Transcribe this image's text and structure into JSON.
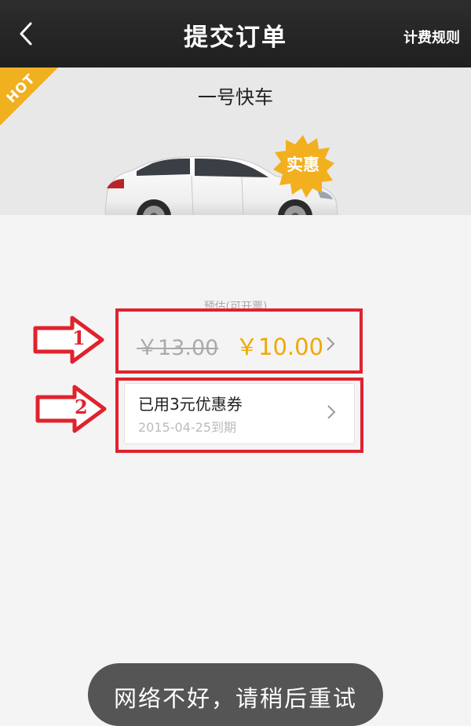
{
  "header": {
    "title": "提交订单",
    "rules_link": "计费规则"
  },
  "banner": {
    "ribbon": "HOT",
    "product_name": "一号快车",
    "badge": "实惠"
  },
  "pricing": {
    "estimate_label": "预估(可开票)",
    "original_price": "￥13.00",
    "discounted_price": "￥10.00"
  },
  "coupon": {
    "title": "已用3元优惠券",
    "expiry": "2015-04-25到期"
  },
  "annotations": {
    "marker_1": "1",
    "marker_2": "2"
  },
  "toast": {
    "message": "网络不好，请稍后重试"
  },
  "colors": {
    "header_bg": "#262626",
    "accent_yellow": "#f0a800",
    "annotation_red": "#e0222d",
    "muted_text": "#aaaaaa"
  },
  "icons": {
    "back": "chevron-left-icon",
    "row_chevron": "chevron-right-icon"
  }
}
